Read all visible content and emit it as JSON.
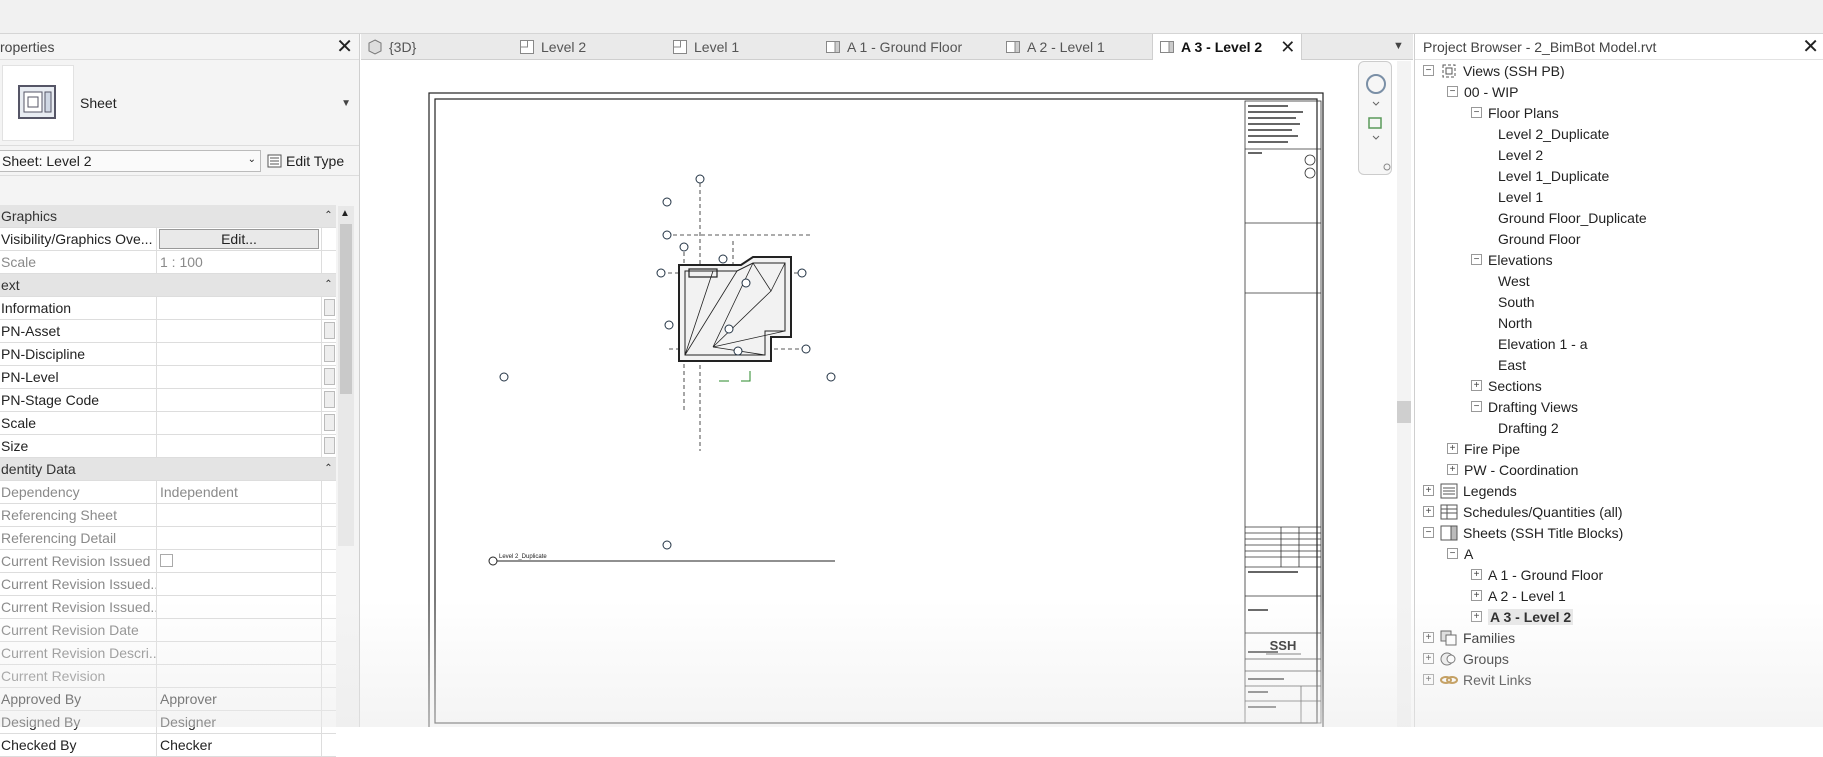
{
  "properties": {
    "title": "roperties",
    "type_name": "Sheet",
    "selector_value": "Sheet: Level 2",
    "edit_type_label": "Edit Type",
    "rows": [
      {
        "kind": "group",
        "label": "Graphics"
      },
      {
        "kind": "row",
        "label": "Visibility/Graphics Ove...",
        "value": "Edit...",
        "button": true
      },
      {
        "kind": "row",
        "label": "Scale",
        "value": "1 : 100",
        "grey": true
      },
      {
        "kind": "group",
        "label": "ext"
      },
      {
        "kind": "row",
        "label": "Information",
        "value": "",
        "sb": true
      },
      {
        "kind": "row",
        "label": "PN-Asset",
        "value": "",
        "sb": true
      },
      {
        "kind": "row",
        "label": "PN-Discipline",
        "value": "",
        "sb": true
      },
      {
        "kind": "row",
        "label": "PN-Level",
        "value": "",
        "sb": true
      },
      {
        "kind": "row",
        "label": "PN-Stage Code",
        "value": "",
        "sb": true
      },
      {
        "kind": "row",
        "label": "Scale",
        "value": "",
        "sb": true
      },
      {
        "kind": "row",
        "label": "Size",
        "value": "",
        "sb": true
      },
      {
        "kind": "group",
        "label": "dentity Data"
      },
      {
        "kind": "row",
        "label": "Dependency",
        "value": "Independent",
        "grey": true
      },
      {
        "kind": "row",
        "label": "Referencing Sheet",
        "value": "",
        "grey": true
      },
      {
        "kind": "row",
        "label": "Referencing Detail",
        "value": "",
        "grey": true
      },
      {
        "kind": "row",
        "label": "Current Revision Issued",
        "value": "",
        "grey": true,
        "check": true
      },
      {
        "kind": "row",
        "label": "Current Revision Issued...",
        "value": "",
        "grey": true
      },
      {
        "kind": "row",
        "label": "Current Revision Issued...",
        "value": "",
        "grey": true
      },
      {
        "kind": "row",
        "label": "Current Revision Date",
        "value": "",
        "grey": true
      },
      {
        "kind": "row",
        "label": "Current Revision Descri...",
        "value": "",
        "grey": true
      },
      {
        "kind": "row",
        "label": "Current Revision",
        "value": "",
        "grey": true
      },
      {
        "kind": "row",
        "label": "Approved By",
        "value": "Approver"
      },
      {
        "kind": "row",
        "label": "Designed By",
        "value": "Designer"
      },
      {
        "kind": "row",
        "label": "Checked By",
        "value": "Checker"
      }
    ]
  },
  "tabs": [
    {
      "label": "{3D}",
      "icon": "3d-view-icon",
      "width": 152
    },
    {
      "label": "Level 2",
      "icon": "floor-plan-icon",
      "width": 153
    },
    {
      "label": "Level 1",
      "icon": "floor-plan-icon",
      "width": 153
    },
    {
      "label": "A 1 - Ground Floor",
      "icon": "sheet-icon",
      "width": 180
    },
    {
      "label": "A 2 - Level 1",
      "icon": "sheet-icon",
      "width": 153
    },
    {
      "label": "A 3 - Level 2",
      "icon": "sheet-icon",
      "width": 150,
      "active": true
    }
  ],
  "sheet": {
    "view_title": "Level 2_Duplicate",
    "logo": "SSH"
  },
  "browser": {
    "title": "Project Browser - 2_BimBot Model.rvt",
    "nodes": [
      {
        "label": "Views (SSH PB)",
        "level": 0,
        "toggle": "−",
        "icon": "views-icon"
      },
      {
        "label": "00 - WIP",
        "level": 1,
        "toggle": "−"
      },
      {
        "label": "Floor Plans",
        "level": 2,
        "toggle": "−"
      },
      {
        "label": "Level 2_Duplicate",
        "level": 3
      },
      {
        "label": "Level 2",
        "level": 3
      },
      {
        "label": "Level 1_Duplicate",
        "level": 3
      },
      {
        "label": "Level 1",
        "level": 3
      },
      {
        "label": "Ground Floor_Duplicate",
        "level": 3
      },
      {
        "label": "Ground Floor",
        "level": 3
      },
      {
        "label": "Elevations",
        "level": 2,
        "toggle": "−"
      },
      {
        "label": "West",
        "level": 3
      },
      {
        "label": "South",
        "level": 3
      },
      {
        "label": "North",
        "level": 3
      },
      {
        "label": "Elevation 1 - a",
        "level": 3
      },
      {
        "label": "East",
        "level": 3
      },
      {
        "label": "Sections",
        "level": 2,
        "toggle": "+"
      },
      {
        "label": "Drafting Views",
        "level": 2,
        "toggle": "−"
      },
      {
        "label": "Drafting 2",
        "level": 3
      },
      {
        "label": "Fire Pipe",
        "level": 1,
        "toggle": "+"
      },
      {
        "label": "PW - Coordination",
        "level": 1,
        "toggle": "+"
      },
      {
        "label": "Legends",
        "level": 0,
        "toggle": "+",
        "icon": "legends-icon"
      },
      {
        "label": "Schedules/Quantities (all)",
        "level": 0,
        "toggle": "+",
        "icon": "schedules-icon"
      },
      {
        "label": "Sheets (SSH Title Blocks)",
        "level": 0,
        "toggle": "−",
        "icon": "sheets-icon"
      },
      {
        "label": "A",
        "level": 1,
        "toggle": "−"
      },
      {
        "label": "A 1 - Ground Floor",
        "level": 2,
        "toggle": "+"
      },
      {
        "label": "A 2 - Level 1",
        "level": 2,
        "toggle": "+"
      },
      {
        "label": "A 3 - Level 2",
        "level": 2,
        "toggle": "+",
        "selected": true
      },
      {
        "label": "Families",
        "level": 0,
        "toggle": "+",
        "icon": "families-icon"
      },
      {
        "label": "Groups",
        "level": 0,
        "toggle": "+",
        "icon": "groups-icon"
      },
      {
        "label": "Revit Links",
        "level": 0,
        "toggle": "+",
        "icon": "revit-links-icon"
      }
    ]
  }
}
